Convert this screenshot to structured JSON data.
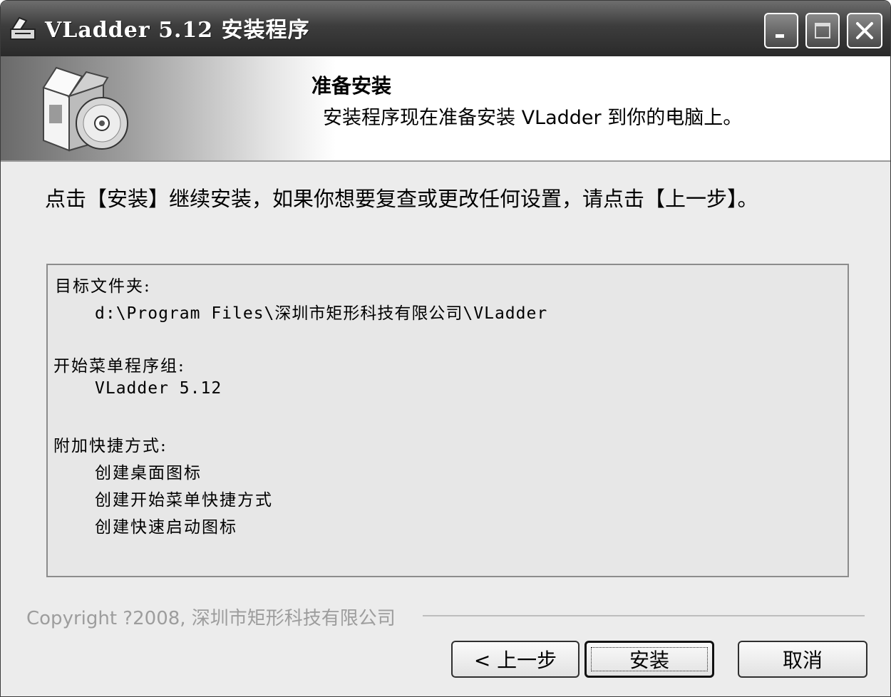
{
  "window": {
    "title": "VLadder 5.12 安装程序",
    "controls": [
      "minimize-icon",
      "maximize-icon",
      "close-icon"
    ]
  },
  "header": {
    "title": "准备安装",
    "subtitle": "安装程序现在准备安装 VLadder 到你的电脑上。"
  },
  "instruction": "点击【安装】继续安装，如果你想要复查或更改任何设置，请点击【上一步】。",
  "summary": {
    "dest_label": "目标文件夹:",
    "dest_value": "d:\\Program Files\\深圳市矩形科技有限公司\\VLadder",
    "menu_label": "开始菜单程序组:",
    "menu_value": "VLadder 5.12",
    "shortcut_label": "附加快捷方式:",
    "shortcuts": [
      "创建桌面图标",
      "创建开始菜单快捷方式",
      "创建快速启动图标"
    ]
  },
  "footer": {
    "copyright": "Copyright ?2008, 深圳市矩形科技有限公司"
  },
  "buttons": {
    "back": "< 上一步",
    "install": "安装",
    "cancel": "取消"
  }
}
